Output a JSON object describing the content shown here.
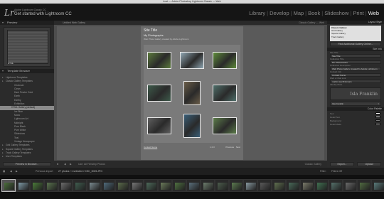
{
  "os": {
    "window_title": "lrcat — Adobe Photoshop Lightroom Classic — Web"
  },
  "identity": {
    "logo": "Lr",
    "line1": "Adobe Lightroom Classic CC",
    "line2": "Get started with Lightroom CC"
  },
  "modules": [
    "Library",
    "Develop",
    "Map",
    "Book",
    "Slideshow",
    "Print",
    "Web"
  ],
  "active_module": "Web",
  "left": {
    "preview_header": "Preview",
    "preview_label": "HTML",
    "browser_header": "Template Browser",
    "templates": [
      {
        "label": "Lightroom Templates",
        "kind": "grp"
      },
      {
        "label": "Classic Gallery Templates",
        "kind": "grp"
      },
      {
        "label": "Charcoal",
        "kind": "sub"
      },
      {
        "label": "Clean",
        "kind": "sub"
      },
      {
        "label": "Dark Pewter Gold",
        "kind": "sub"
      },
      {
        "label": "Earth",
        "kind": "sub"
      },
      {
        "label": "Earthy",
        "kind": "sub"
      },
      {
        "label": "Exhibition",
        "kind": "sub"
      },
      {
        "label": "HTML Gallery (default)",
        "kind": "sel"
      },
      {
        "label": "Ice Blue",
        "kind": "sub"
      },
      {
        "label": "Mono",
        "kind": "sub"
      },
      {
        "label": "Lightroom Art",
        "kind": "sub"
      },
      {
        "label": "Midnight",
        "kind": "sub"
      },
      {
        "label": "Pure Black",
        "kind": "sub"
      },
      {
        "label": "Pure White",
        "kind": "sub"
      },
      {
        "label": "Slideshow",
        "kind": "sub"
      },
      {
        "label": "Teal",
        "kind": "sub"
      },
      {
        "label": "Vintage Newspaper",
        "kind": "sub"
      },
      {
        "label": "Grid Gallery Templates",
        "kind": "grp"
      },
      {
        "label": "Square Gallery Templates",
        "kind": "grp"
      },
      {
        "label": "Track Gallery Templates",
        "kind": "grp"
      },
      {
        "label": "User Templates",
        "kind": "grp"
      }
    ],
    "btn_preview": "Preview in Browser..."
  },
  "center": {
    "gallery_type": "Classic Gallery",
    "title_small": "Untitled Web Gallery",
    "right_small": "Classic Gallery — Web",
    "site_title": "Site Title",
    "collection_title": "My Photographs",
    "description": "Web Photo Gallery created by Adobe Lightroom",
    "contact": "Contact Name",
    "pager": "1  2  3",
    "prev": "Previous",
    "next": "Next",
    "bottom_left": "Previous Page",
    "bottom_mid": "Use: All Filmstrip Photos",
    "bottom_right": "Classic Gallery",
    "photo_tints": [
      "#5b7a3c",
      "#8fa6b2",
      "#5e8b3a",
      "#3d5a4a",
      "#6a5d48",
      "#4f6f6a",
      "#606060",
      "#3a5f78",
      "#5c7c4a"
    ]
  },
  "right": {
    "layout_header": "Layout Style",
    "layout_options": [
      "Classic Gallery",
      "Grid Gallery",
      "Square Gallery",
      "Track Gallery"
    ],
    "layout_button": "Find Additional Gallery Online...",
    "site_info_header": "Site Info",
    "fields": [
      {
        "label": "Site Title",
        "value": "Site Title"
      },
      {
        "label": "Collection Title",
        "value": "My Photographs"
      },
      {
        "label": "Collection Description",
        "value": "Web Photo Gallery created by Adobe Lightroom"
      },
      {
        "label": "Contact Info",
        "value": "Contact Name"
      },
      {
        "label": "Web or Mail Link",
        "value": "mailto:user@domain"
      }
    ],
    "identity_label": "Identity Plate",
    "identity_text": "Isla Franklin",
    "identity_dropdown": "Isla Franklin",
    "color_header": "Color Palette",
    "colors": [
      {
        "label": "Text",
        "hex": "#ffffff"
      },
      {
        "label": "Detail Text",
        "hex": "#ffffff"
      },
      {
        "label": "Background",
        "hex": "#7a7a7a"
      },
      {
        "label": "Detail Matte",
        "hex": "#dddddd"
      }
    ],
    "btn_export": "Export...",
    "btn_upload": "Upload"
  },
  "filmstrip": {
    "header": "Previous Import",
    "count": "27 photos / 1 selected / DSC_3025.JPG",
    "filter_label": "Filter:",
    "filter_value": "Filters Off",
    "thumbs": [
      "#4b6e3b",
      "#7e9aa6",
      "#4a7a38",
      "#59724d",
      "#6b6b6b",
      "#3f5c4e",
      "#7a8a90",
      "#4f6a7a",
      "#5a6a4a",
      "#777777",
      "#4d6a5a",
      "#6a7a5a",
      "#4f7040",
      "#5a6e7a",
      "#6c7c6c",
      "#4b5b4b",
      "#5c7a50",
      "#8899a0",
      "#5a5a5a",
      "#607050",
      "#486858",
      "#7a7a6a",
      "#3f6f50",
      "#55706a",
      "#6a6a6a",
      "#506a40",
      "#5a7a7a"
    ]
  }
}
